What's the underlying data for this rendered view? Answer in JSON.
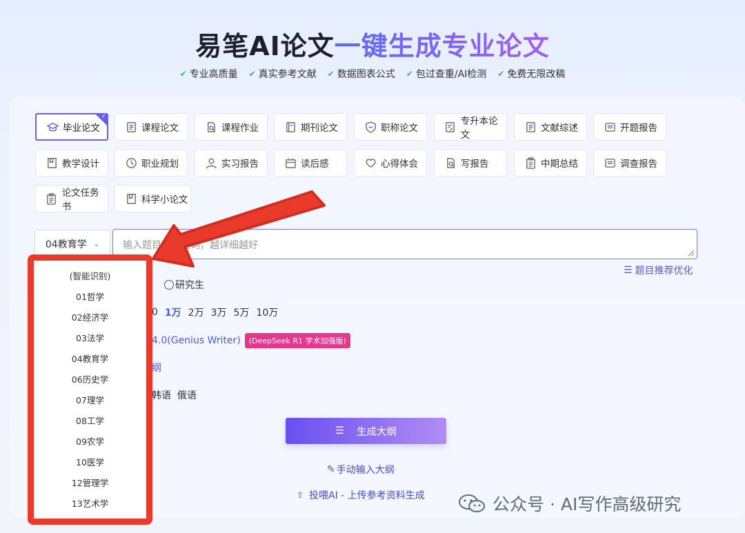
{
  "hero": {
    "title_part1": "易笔AI论文",
    "title_part2": "一键生成专业论文",
    "features": [
      "专业高质量",
      "真实参考文献",
      "数据图表公式",
      "包过查重/AI检测",
      "免费无限改稿"
    ]
  },
  "paper_types": [
    {
      "label": "毕业论文",
      "icon": "graduation-cap-icon",
      "active": true
    },
    {
      "label": "课程论文",
      "icon": "document-icon"
    },
    {
      "label": "课程作业",
      "icon": "document-search-icon"
    },
    {
      "label": "期刊论文",
      "icon": "journal-icon"
    },
    {
      "label": "职称论文",
      "icon": "shield-icon"
    },
    {
      "label": "专升本论文",
      "icon": "document-edit-icon"
    },
    {
      "label": "文献综述",
      "icon": "document-icon"
    },
    {
      "label": "开题报告",
      "icon": "report-icon"
    },
    {
      "label": "教学设计",
      "icon": "book-icon"
    },
    {
      "label": "职业规划",
      "icon": "clock-icon"
    },
    {
      "label": "实习报告",
      "icon": "user-icon"
    },
    {
      "label": "读后感",
      "icon": "calendar-icon"
    },
    {
      "label": "心得体会",
      "icon": "heart-icon"
    },
    {
      "label": "写报告",
      "icon": "document-search-icon"
    },
    {
      "label": "中期总结",
      "icon": "clipboard-icon"
    },
    {
      "label": "调查报告",
      "icon": "report-icon"
    },
    {
      "label": "论文任务书",
      "icon": "clipboard-icon"
    },
    {
      "label": "科学小论文",
      "icon": "book-icon"
    }
  ],
  "subject_select": {
    "value": "04教育学"
  },
  "topic_input": {
    "placeholder": "输入题目或关键词，越详细越好"
  },
  "recommend_link": "题目推荐优化",
  "degree": {
    "option_visible": "研究生"
  },
  "word_count": {
    "prefix": "0",
    "options": [
      "1万",
      "2万",
      "3万",
      "5万",
      "10万"
    ],
    "selected": "1万"
  },
  "model": {
    "label": "4.0(Genius Writer)",
    "badge": "(DeepSeek R1 学术加强版)"
  },
  "outline_partial": "纲",
  "languages_partial": "韩语  俄语",
  "generate_button": "生成大纲",
  "manual_outline": "手动输入大纲",
  "upload_link": "投喂AI - 上传参考资料生成",
  "dropdown_options": [
    "(智能识别)",
    "01哲学",
    "02经济学",
    "03法学",
    "04教育学",
    "06历史学",
    "07理学",
    "08工学",
    "09农学",
    "10医学",
    "12管理学",
    "13艺术学"
  ],
  "watermark": "公众号 · AI写作高级研究",
  "colors": {
    "accent": "#6a5cf0",
    "highlight": "#ea3a2c",
    "link": "#4a5ae8",
    "badge": "#e8368f"
  }
}
